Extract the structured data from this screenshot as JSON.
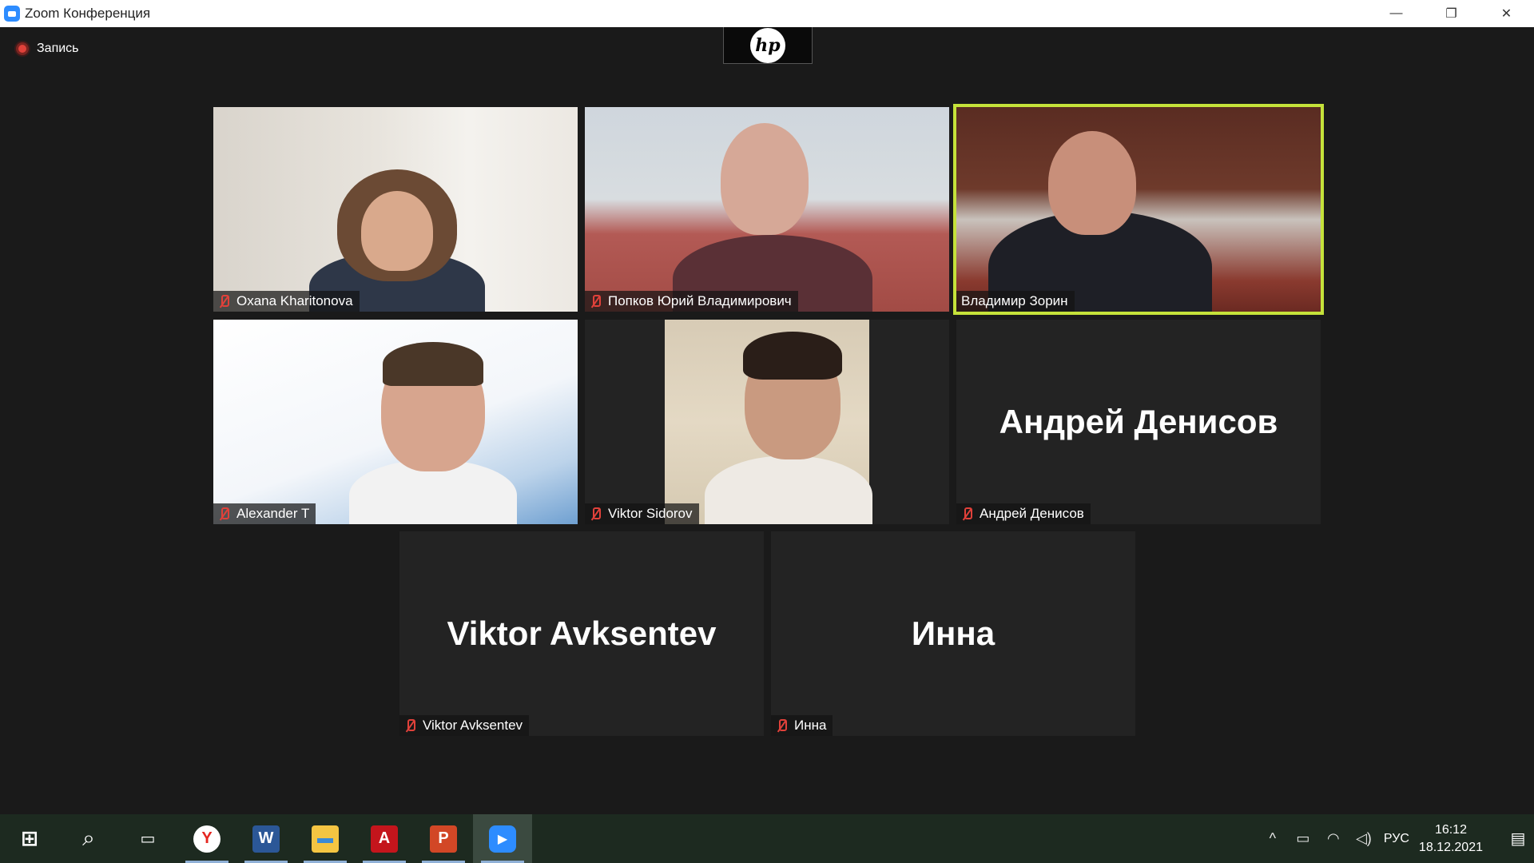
{
  "window": {
    "title": "Zoom Конференция",
    "minimize": "—",
    "restore": "❐",
    "close": "✕"
  },
  "recording": {
    "label": "Запись"
  },
  "hp_logo": "hp",
  "participants": [
    {
      "name": "Oxana Kharitonova",
      "muted": true,
      "video": true
    },
    {
      "name": "Попков Юрий Владимирович",
      "muted": true,
      "video": true
    },
    {
      "name": "Владимир Зорин",
      "muted": false,
      "video": true,
      "active_speaker": true
    },
    {
      "name": "Alexander T",
      "muted": true,
      "video": true
    },
    {
      "name": "Viktor Sidorov",
      "muted": true,
      "video": true
    },
    {
      "name": "Андрей Денисов",
      "muted": true,
      "video": false,
      "display": "Андрей Денисов"
    },
    {
      "name": "Viktor Avksentev",
      "muted": true,
      "video": false,
      "display": "Viktor Avksentev"
    },
    {
      "name": "Инна",
      "muted": true,
      "video": false,
      "display": "Инна"
    }
  ],
  "taskbar": {
    "apps": [
      {
        "name": "start",
        "glyph": "⊞"
      },
      {
        "name": "search",
        "glyph": "⌕"
      },
      {
        "name": "task-view",
        "glyph": "▭"
      },
      {
        "name": "yandex-browser",
        "glyph": "Y"
      },
      {
        "name": "word",
        "glyph": "W"
      },
      {
        "name": "file-explorer",
        "glyph": "▬"
      },
      {
        "name": "acrobat",
        "glyph": "A"
      },
      {
        "name": "powerpoint",
        "glyph": "P"
      },
      {
        "name": "zoom",
        "glyph": "▶"
      }
    ],
    "tray": {
      "chevron": "^",
      "battery": "▭",
      "wifi": "◠",
      "volume": "◁)",
      "language": "РУС",
      "time": "16:12",
      "date": "18.12.2021",
      "notifications": "▤"
    }
  }
}
